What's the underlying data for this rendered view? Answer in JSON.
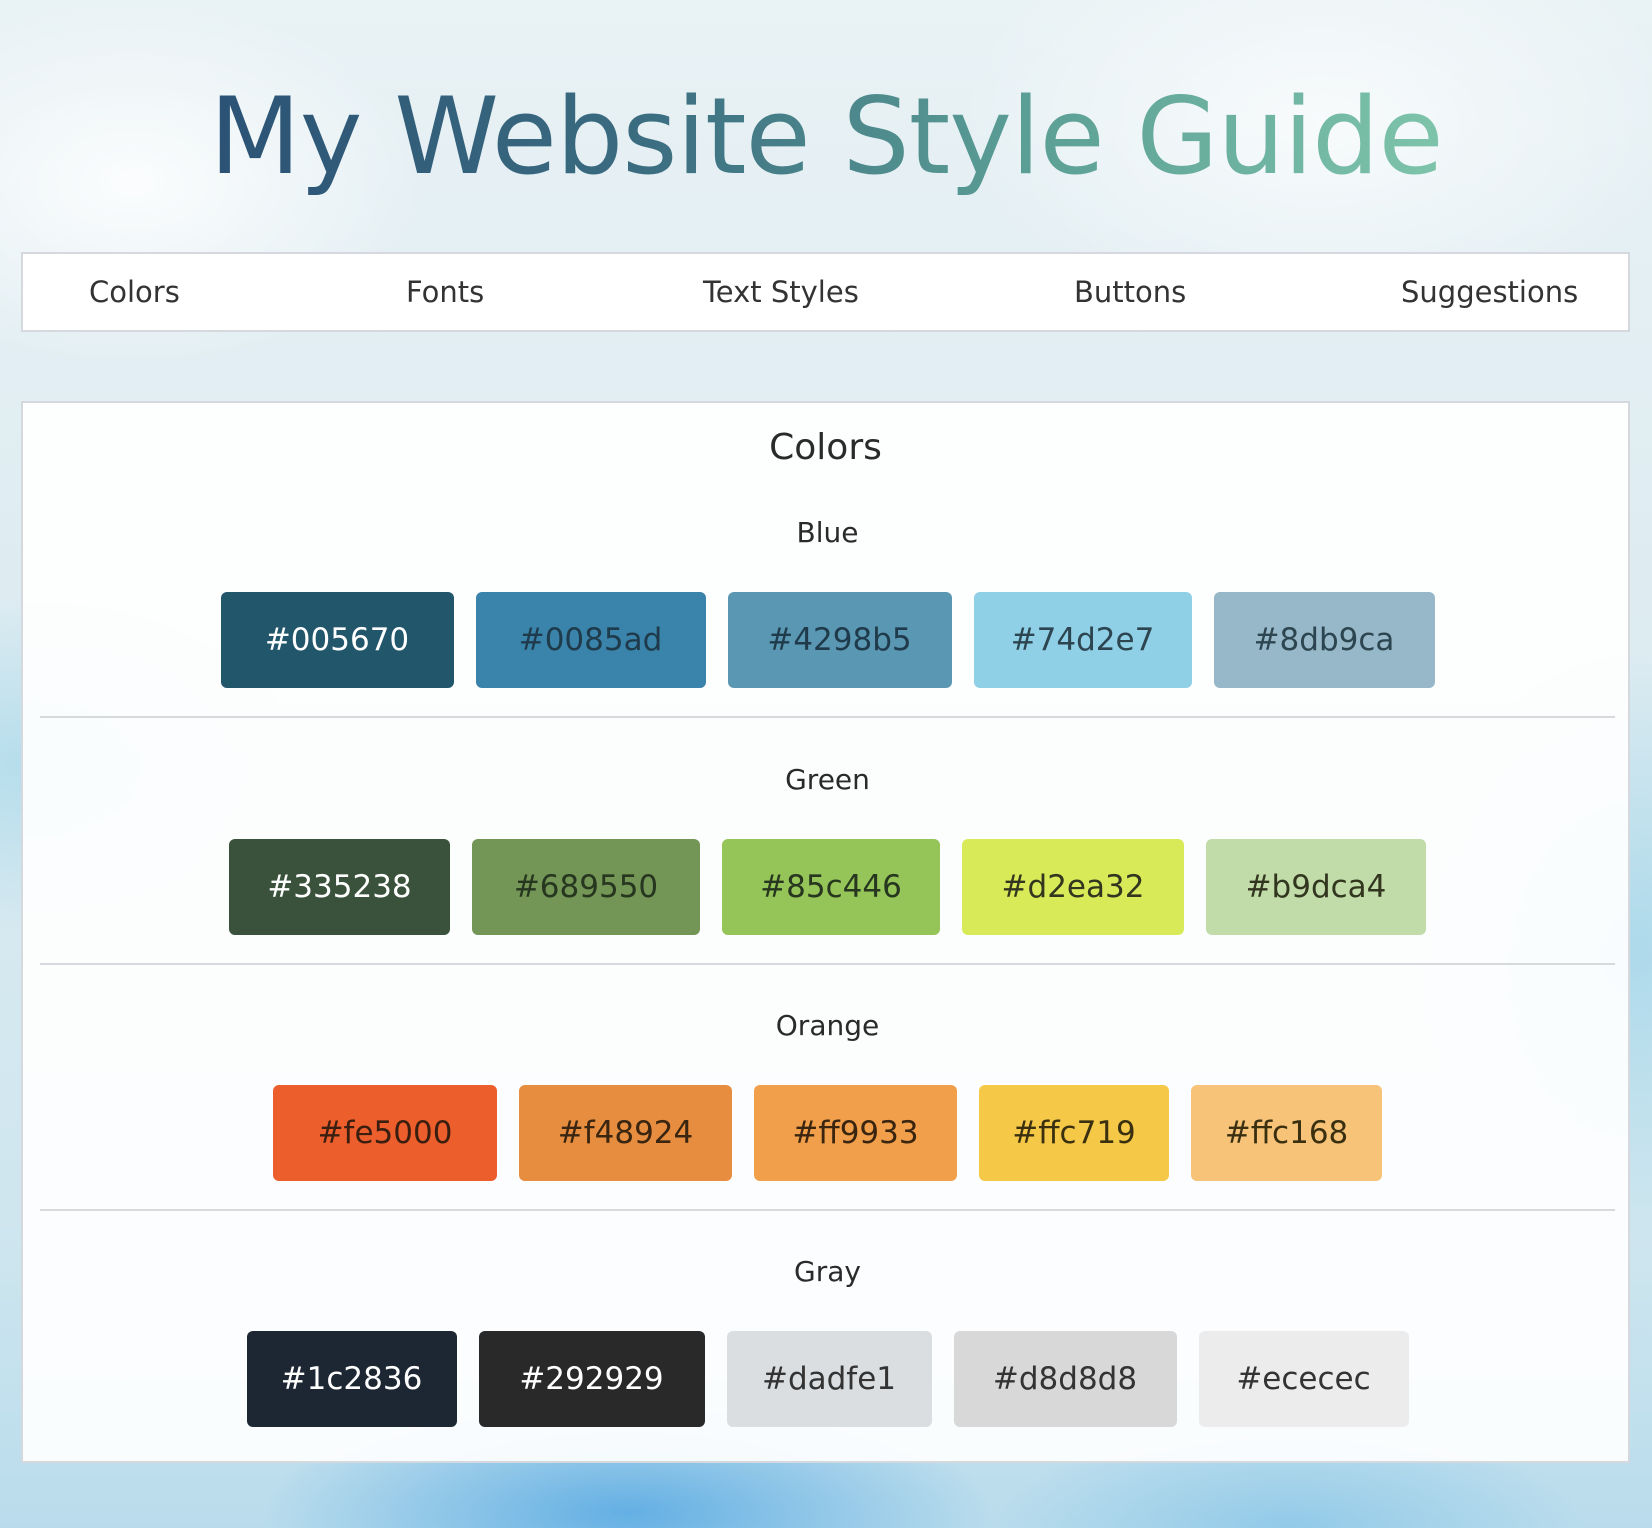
{
  "title": "My Website Style Guide",
  "nav": [
    {
      "label": "Colors"
    },
    {
      "label": "Fonts"
    },
    {
      "label": "Text Styles"
    },
    {
      "label": "Buttons"
    },
    {
      "label": "Suggestions"
    }
  ],
  "section": {
    "title": "Colors",
    "groups": [
      {
        "label": "Blue",
        "swatches": [
          {
            "hex": "#005670",
            "color": "#22566b",
            "text_color": "#ffffff"
          },
          {
            "hex": "#0085ad",
            "color": "#3a84ab",
            "text_color": "#1f3a4a"
          },
          {
            "hex": "#4298b5",
            "color": "#5a97b3",
            "text_color": "#1f3a4a"
          },
          {
            "hex": "#74d2e7",
            "color": "#8fd0e6",
            "text_color": "#2c4550"
          },
          {
            "hex": "#8db9ca",
            "color": "#97b8c8",
            "text_color": "#2c4550"
          }
        ]
      },
      {
        "label": "Green",
        "swatches": [
          {
            "hex": "#335238",
            "color": "#3a523b",
            "text_color": "#ffffff"
          },
          {
            "hex": "#689550",
            "color": "#739555",
            "text_color": "#26361f"
          },
          {
            "hex": "#85c446",
            "color": "#95c458",
            "text_color": "#26361f"
          },
          {
            "hex": "#d2ea32",
            "color": "#d8ea58",
            "text_color": "#33361f"
          },
          {
            "hex": "#b9dca4",
            "color": "#c1dca9",
            "text_color": "#33361f"
          }
        ]
      },
      {
        "label": "Orange",
        "swatches": [
          {
            "hex": "#fe5000",
            "color": "#ec5e2c",
            "text_color": "#3a1e10"
          },
          {
            "hex": "#f48924",
            "color": "#e78d3f",
            "text_color": "#3a2510"
          },
          {
            "hex": "#ff9933",
            "color": "#f19f4a",
            "text_color": "#3a2510"
          },
          {
            "hex": "#ffc719",
            "color": "#f5c947",
            "text_color": "#3a3010"
          },
          {
            "hex": "#ffc168",
            "color": "#f6c379",
            "text_color": "#3a3010"
          }
        ]
      },
      {
        "label": "Gray",
        "swatches": [
          {
            "hex": "#1c2836",
            "color": "#1d2733",
            "text_color": "#ffffff"
          },
          {
            "hex": "#292929",
            "color": "#292929",
            "text_color": "#ffffff"
          },
          {
            "hex": "#dadfe1",
            "color": "#dadee1",
            "text_color": "#333333"
          },
          {
            "hex": "#d8d8d8",
            "color": "#d8d8d8",
            "text_color": "#333333"
          },
          {
            "hex": "#ececec",
            "color": "#ececec",
            "text_color": "#333333"
          }
        ]
      }
    ]
  },
  "colors": {
    "title_gradient_start": "#24466f",
    "title_gradient_end": "#8fd7b5",
    "border": "#d5d8dc"
  }
}
